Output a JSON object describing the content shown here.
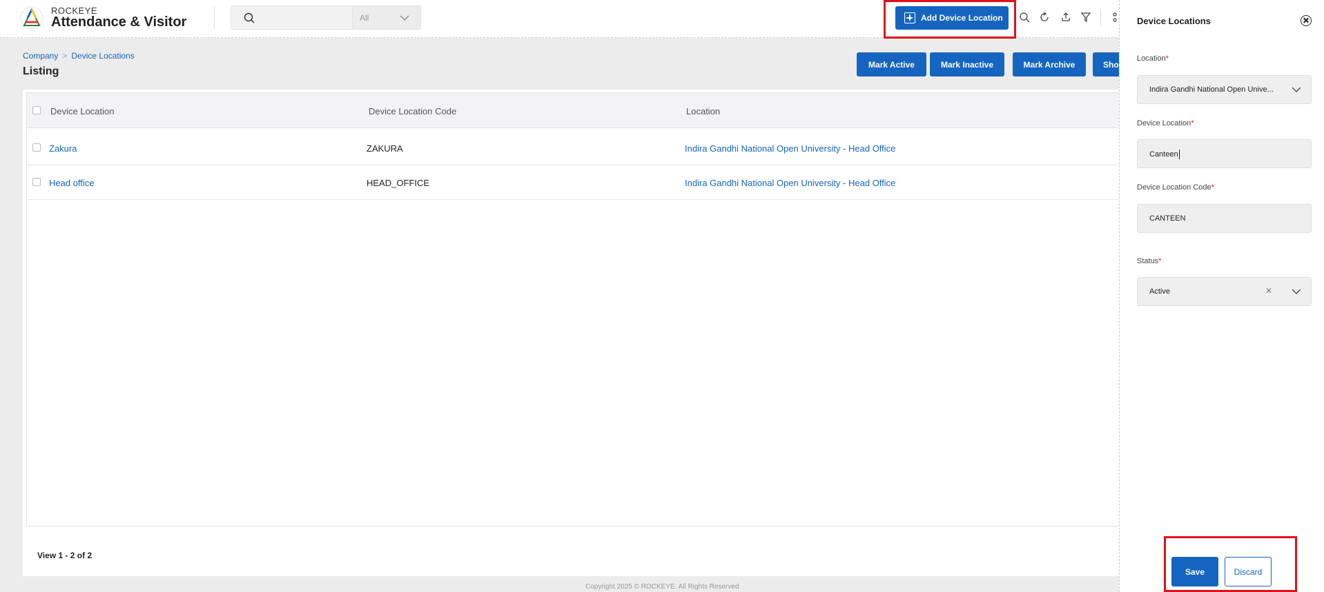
{
  "app": {
    "brand_top": "ROCKEYE",
    "brand_main": "Attendance & Visitor"
  },
  "search": {
    "value": "",
    "scope": "All"
  },
  "header": {
    "add_button": "Add Device Location"
  },
  "breadcrumb": {
    "items": [
      "Company",
      "Device Locations"
    ]
  },
  "page": {
    "title": "Listing"
  },
  "actions": [
    "Mark Active",
    "Mark Inactive",
    "Mark Archive",
    "Sho"
  ],
  "table": {
    "columns": [
      "Device Location",
      "Device Location Code",
      "Location"
    ],
    "rows": [
      {
        "name": "Zakura",
        "code": "ZAKURA",
        "location": "Indira Gandhi National Open University - Head Office"
      },
      {
        "name": "Head office",
        "code": "HEAD_OFFICE",
        "location": "Indira Gandhi National Open University - Head Office"
      }
    ],
    "view_count": "View 1 - 2 of 2"
  },
  "footer": {
    "copyright": "Copyright 2025 © ROCKEYE. All Rights Reserved"
  },
  "panel": {
    "title": "Device Locations",
    "location_label": "Location",
    "location_value": "Indira Gandhi National Open Unive...",
    "device_location_label": "Device Location",
    "device_location_value": "Canteen",
    "code_label": "Device Location Code",
    "code_value": "CANTEEN",
    "status_label": "Status",
    "status_value": "Active",
    "save": "Save",
    "discard": "Discard",
    "required_mark": "*"
  },
  "colors": {
    "primary": "#1565c0",
    "highlight": "#e0101a",
    "required": "#e0101a"
  },
  "icons": [
    "search-icon",
    "chevron-down-icon",
    "plus-icon",
    "refresh-icon",
    "export-icon",
    "filter-icon",
    "close-circle-icon",
    "clear-icon"
  ]
}
